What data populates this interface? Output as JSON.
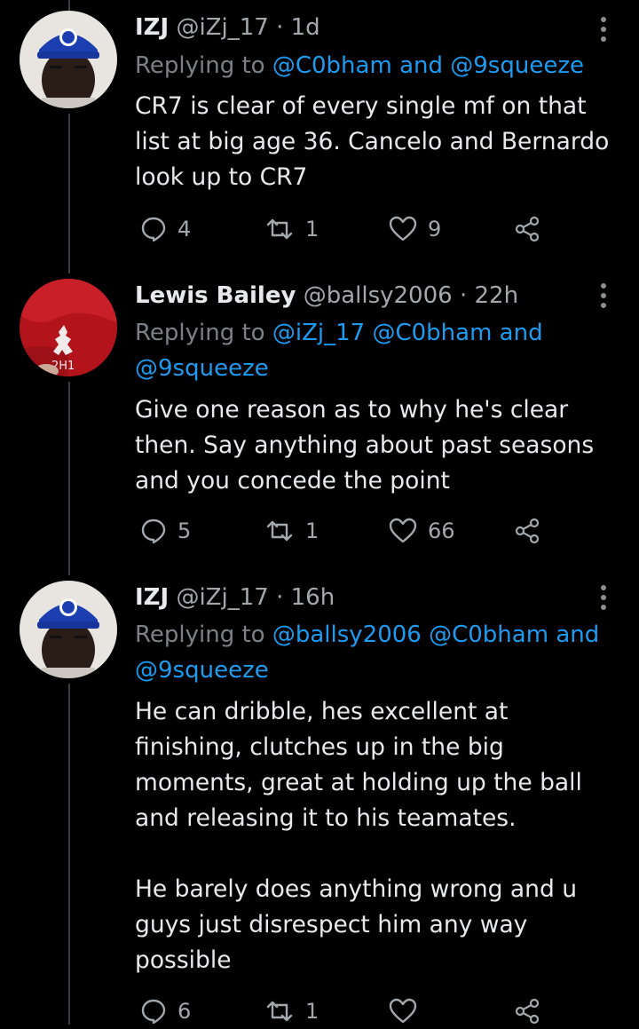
{
  "tweets": [
    {
      "name": "IZJ",
      "handle": "@iZj_17",
      "dot": "·",
      "time": "1d",
      "replying_prefix": "Replying to ",
      "reply_line1_mention1": "@C0bham",
      "reply_line1_and": " and ",
      "reply_line1_mention2": "@9squeeze",
      "text": "CR7 is clear of every single mf on that\nlist at big age 36. Cancelo and Bernardo\nlook up to CR7",
      "replies": "4",
      "retweets": "1",
      "likes": "9",
      "avatar_icon": "avatar-chelsea-hat"
    },
    {
      "name": "Lewis Bailey",
      "handle": "@ballsy2006",
      "dot": "·",
      "time": "22h",
      "replying_prefix": "Replying to ",
      "reply_line1_mention1": "@iZj_17",
      "reply_line1_mention2": "@C0bham",
      "reply_line1_and": " and",
      "reply_line2_mention": "@9squeeze",
      "text": "Give one reason as to why he's clear\nthen. Say anything about past seasons\nand you concede the point",
      "replies": "5",
      "retweets": "1",
      "likes": "66",
      "avatar_icon": "avatar-liverpool-shirt"
    },
    {
      "name": "IZJ",
      "handle": "@iZj_17",
      "dot": "·",
      "time": "16h",
      "replying_prefix": "Replying to ",
      "reply_line1_mention1": "@ballsy2006",
      "reply_line1_mention2": "@C0bham",
      "reply_line1_and": " and",
      "reply_line2_mention": "@9squeeze",
      "text": "He can dribble, hes excellent at\nfinishing, clutches up in the big\nmoments, great at holding up the ball\nand releasing it to his teamates.\n\nHe barely does anything wrong and u\nguys just disrespect him any way\npossible",
      "replies": "6",
      "retweets": "1",
      "likes": "",
      "avatar_icon": "avatar-chelsea-hat"
    }
  ],
  "icons": {
    "reply": "reply-icon",
    "retweet": "retweet-icon",
    "like": "heart-icon",
    "share": "share-icon",
    "more": "more-icon"
  },
  "colors": {
    "background": "#000000",
    "text": "#e7e9ea",
    "muted": "#a3a8ad",
    "link": "#1d9bf0",
    "thread_line": "#3a3d41"
  }
}
